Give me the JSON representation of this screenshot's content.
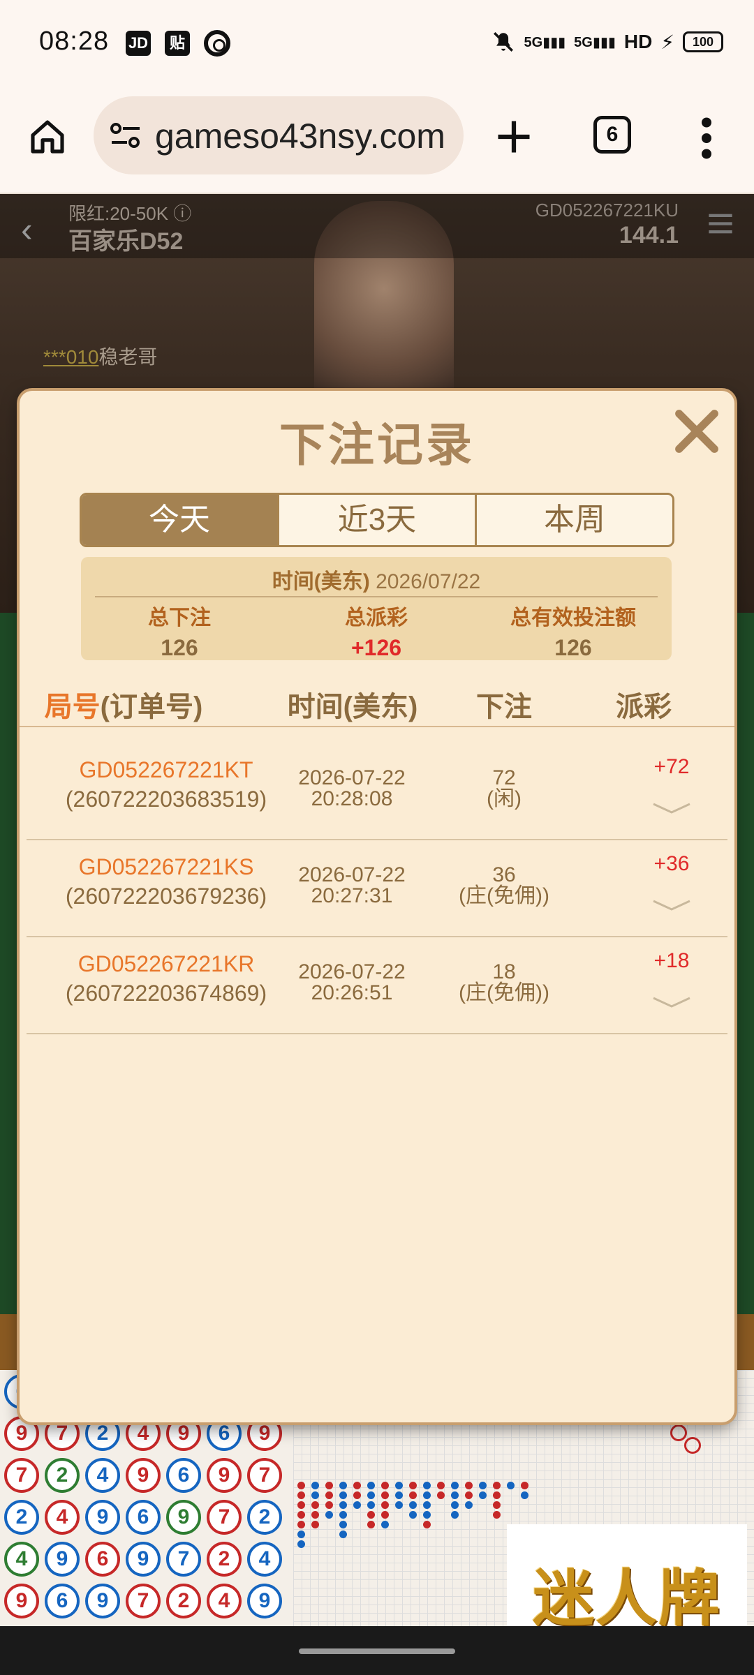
{
  "status_bar": {
    "time": "08:28",
    "app_icons": [
      "JD",
      "贴"
    ],
    "battery": "100",
    "network": "5G"
  },
  "browser": {
    "url": "gameso43nsy.com",
    "tab_count": "6"
  },
  "game": {
    "limit": "限红:20-50K ⓘ",
    "table_name": "百家乐D52",
    "round_id": "GD052267221KU",
    "balance": "144.1",
    "player_mask": "***010",
    "player_name": "稳老哥"
  },
  "modal": {
    "title": "下注记录",
    "tabs": [
      {
        "label": "今天",
        "active": true
      },
      {
        "label": "近3天",
        "active": false
      },
      {
        "label": "本周",
        "active": false
      }
    ],
    "summary": {
      "date_label": "时间(美东)",
      "date": "2026/07/22",
      "total_bet_label": "总下注",
      "total_bet": "126",
      "total_payout_label": "总派彩",
      "total_payout": "+126",
      "total_valid_label": "总有效投注额",
      "total_valid": "126"
    },
    "columns": {
      "round_a": "局号",
      "round_b": "(订单号)",
      "time": "时间(美东)",
      "bet": "下注",
      "payout": "派彩"
    },
    "rows": [
      {
        "round": "GD052267221KT",
        "order": "(260722203683519)",
        "date": "2026-07-22",
        "time": "20:28:08",
        "amount": "72",
        "side": "(闲)",
        "payout": "+72"
      },
      {
        "round": "GD052267221KS",
        "order": "(260722203679236)",
        "date": "2026-07-22",
        "time": "20:27:31",
        "amount": "36",
        "side": "(庄(免佣))",
        "payout": "+36"
      },
      {
        "round": "GD052267221KR",
        "order": "(260722203674869)",
        "date": "2026-07-22",
        "time": "20:26:51",
        "amount": "18",
        "side": "(庄(免佣))",
        "payout": "+18"
      }
    ]
  },
  "watermark": "迷人牌",
  "colors": {
    "accent_gold": "#a48252",
    "payout_red": "#e02a2a",
    "round_orange": "#e8762a",
    "modal_bg": "#fbecd4"
  }
}
